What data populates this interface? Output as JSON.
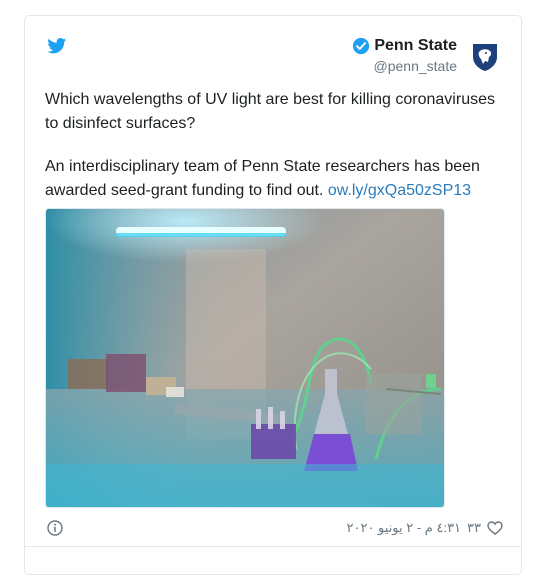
{
  "tweet": {
    "author_name": "Penn State",
    "author_handle": "@penn_state",
    "paragraph1": "Which wavelengths of UV light are best for killing coronaviruses to disinfect surfaces?",
    "paragraph2_text": "An interdisciplinary team of Penn State researchers has been awarded seed-grant funding to find out. ",
    "paragraph2_link": "ow.ly/gxQa50zSP13",
    "like_count": "٣٣",
    "timestamp": "٤:٣١ م - ٢ يونيو ٢٠٢٠"
  },
  "icons": {
    "brand": "twitter-bird-icon",
    "verified": "verified-badge-icon",
    "logo": "penn-state-shield-logo",
    "info": "info-icon",
    "like": "heart-icon"
  },
  "colors": {
    "twitter_blue": "#1da1f2",
    "link": "#2b7bb9",
    "muted": "#697882",
    "border": "#e1e8ed",
    "penn_state_navy": "#1e407c"
  }
}
